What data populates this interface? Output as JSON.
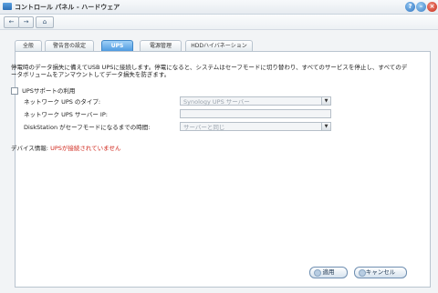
{
  "window": {
    "title": "コントロール パネル - ハードウェア"
  },
  "nav": {
    "back": "←",
    "forward": "→",
    "home": "⌂"
  },
  "tabs": [
    {
      "label": "全般"
    },
    {
      "label": "警告音の設定"
    },
    {
      "label": "UPS"
    },
    {
      "label": "電源管理"
    },
    {
      "label": "HDDハイバネーション"
    }
  ],
  "ups": {
    "description": "停電時のデータ損失に備えてUSB UPSに接続します。停電になると、システムはセーフモードに切り替わり、すべてのサービスを停止し、すべてのデータボリュームをアンマウントしてデータ損失を防ぎます。",
    "enable_label": "UPSサポートの利用",
    "network_type_label": "ネットワーク UPS のタイプ:",
    "network_type_value": "Synology UPS サーバー",
    "server_ip_label": "ネットワーク UPS サーバー IP:",
    "server_ip_value": "",
    "safe_mode_time_label": "DiskStation がセーフモードになるまでの時間:",
    "safe_mode_time_value": "サーバーと同じ",
    "device_info_label": "デバイス情報:",
    "device_info_value": "UPSが接続されていません"
  },
  "buttons": {
    "apply": "適用",
    "cancel": "キャンセル"
  },
  "colors": {
    "active_tab": "#4e9be0",
    "warning_text": "#d0261b"
  }
}
